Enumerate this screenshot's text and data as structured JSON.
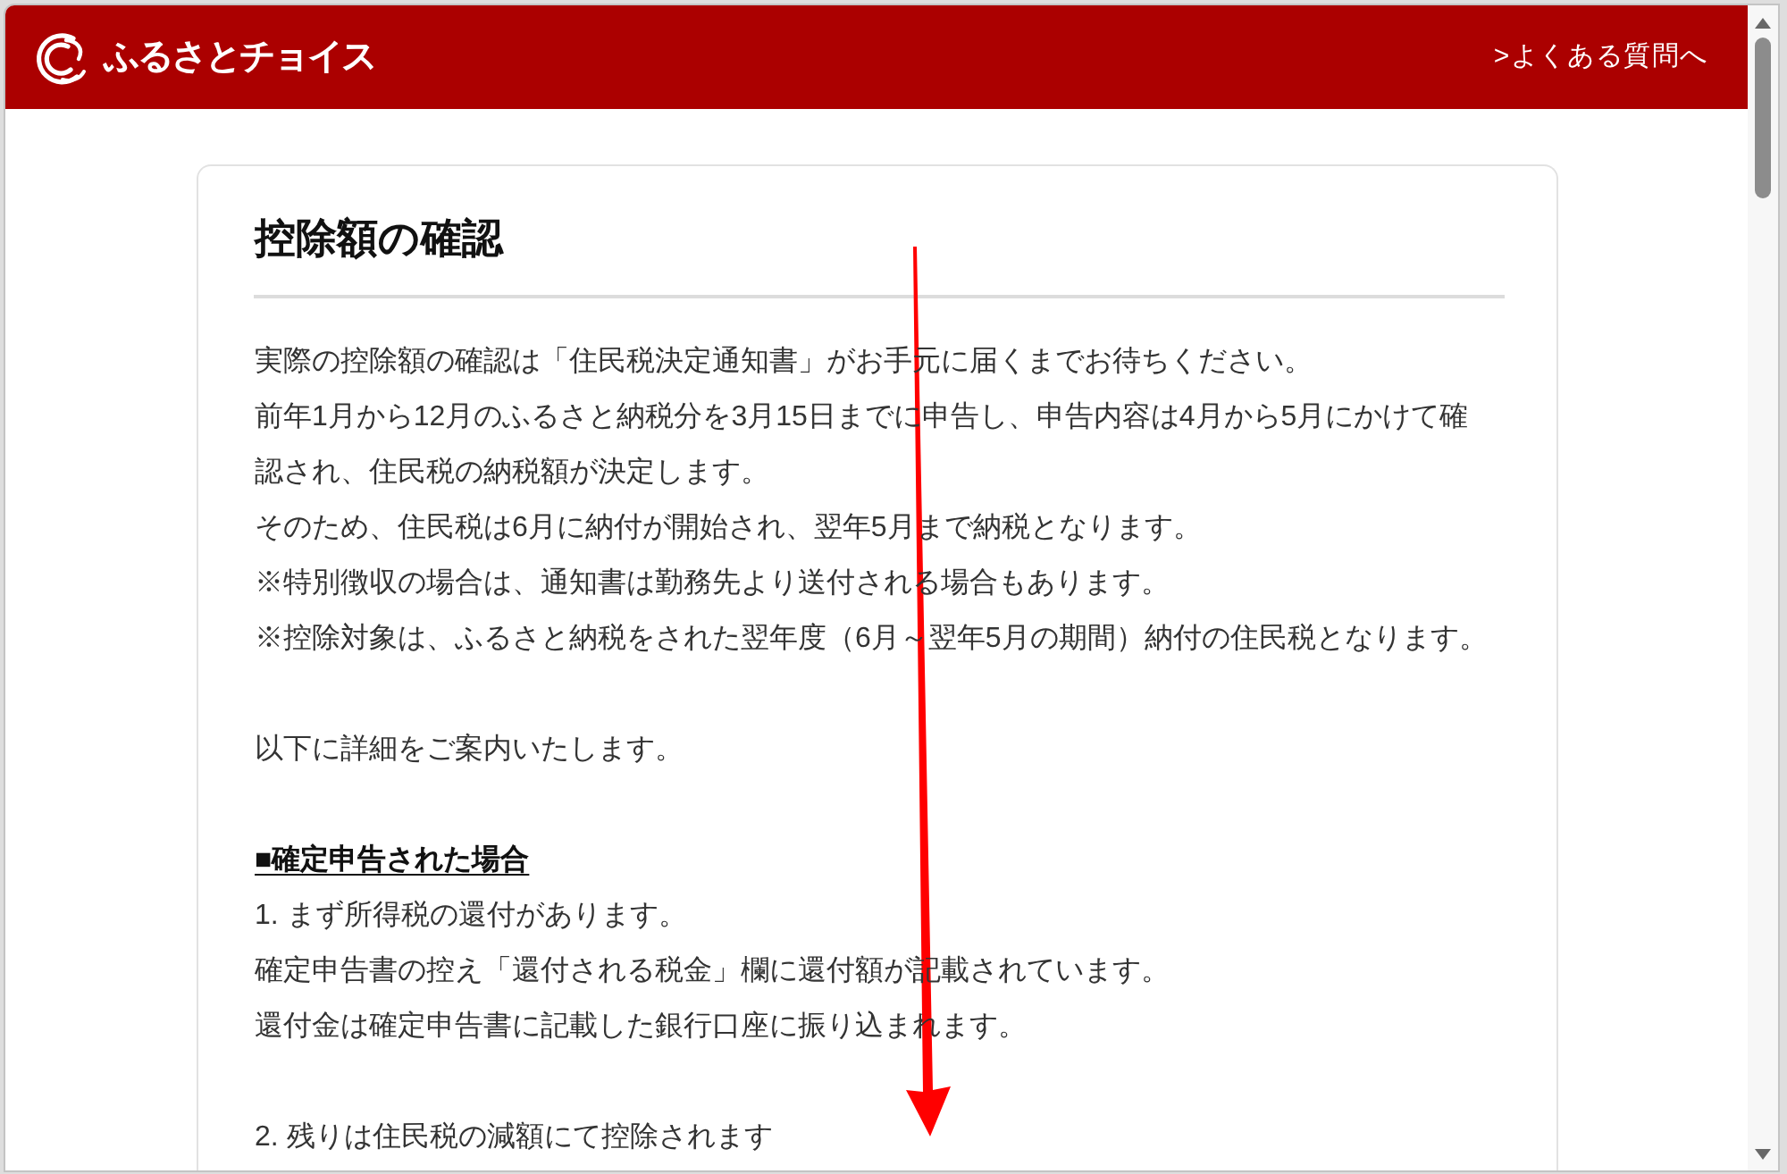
{
  "header": {
    "logo_text": "ふるさとチョイス",
    "faq_link": ">よくある質問へ"
  },
  "card": {
    "title": "控除額の確認",
    "paragraphs": [
      {
        "lines": [
          {
            "kind": "text",
            "text": "実際の控除額の確認は「住民税決定通知書」がお手元に届くまでお待ちください。"
          },
          {
            "kind": "text",
            "text": "前年1月から12月のふるさと納税分を3月15日までに申告し、申告内容は4月から5月にかけて確認され、住民税の納税額が決定します。"
          },
          {
            "kind": "text",
            "text": "そのため、住民税は6月に納付が開始され、翌年5月まで納税となります。"
          },
          {
            "kind": "text",
            "text": "※特別徴収の場合は、通知書は勤務先より送付される場合もあります。"
          },
          {
            "kind": "text",
            "text": "※控除対象は、ふるさと納税をされた翌年度（6月～翌年5月の期間）納付の住民税となります。"
          }
        ]
      },
      {
        "lines": [
          {
            "kind": "text",
            "text": "以下に詳細をご案内いたします。"
          }
        ]
      },
      {
        "lines": [
          {
            "kind": "heading",
            "text": "■確定申告された場合"
          },
          {
            "kind": "text",
            "text": "1. まず所得税の還付があります。"
          },
          {
            "kind": "text",
            "text": "確定申告書の控え「還付される税金」欄に還付額が記載されています。"
          },
          {
            "kind": "text",
            "text": "還付金は確定申告書に記載した銀行口座に振り込まれます。"
          }
        ]
      },
      {
        "lines": [
          {
            "kind": "text",
            "text": "2. 残りは住民税の減額にて控除されます"
          }
        ]
      }
    ]
  }
}
